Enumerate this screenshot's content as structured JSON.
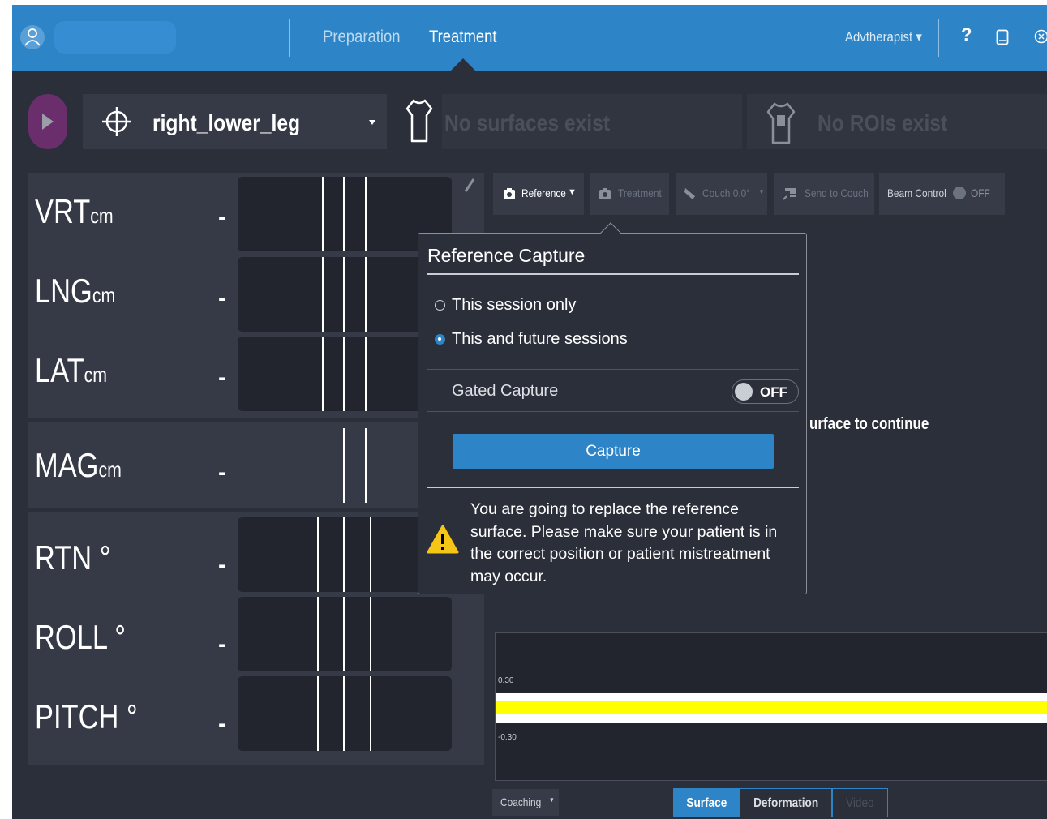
{
  "header": {
    "tabs": [
      {
        "label": "Preparation",
        "active": false
      },
      {
        "label": "Treatment",
        "active": true
      }
    ],
    "user_menu": "Advtherapist",
    "icons": [
      "user-avatar-icon",
      "help-icon",
      "tablet-icon",
      "close-icon"
    ]
  },
  "site": {
    "name": "right_lower_leg",
    "surfaces_text": "No surfaces exist",
    "rois_text": "No ROIs exist"
  },
  "deltas": {
    "rows": [
      {
        "axis": "VRT",
        "unit": "cm",
        "value": "-"
      },
      {
        "axis": "LNG",
        "unit": "cm",
        "value": "-"
      },
      {
        "axis": "LAT",
        "unit": "cm",
        "value": "-"
      },
      {
        "axis": "MAG",
        "unit": "cm",
        "value": "-"
      },
      {
        "axis": "RTN",
        "unit": "°",
        "value": "-"
      },
      {
        "axis": "ROLL",
        "unit": "°",
        "value": "-"
      },
      {
        "axis": "PITCH",
        "unit": "°",
        "value": "-"
      }
    ]
  },
  "toolbar": {
    "reference": "Reference",
    "treatment": "Treatment",
    "couch": "Couch 0.0°",
    "send_to_couch": "Send to Couch",
    "beam_control": "Beam Control",
    "beam_state": "OFF"
  },
  "popup": {
    "title": "Reference Capture",
    "options": [
      {
        "label": "This session only",
        "selected": false
      },
      {
        "label": "This and future sessions",
        "selected": true
      }
    ],
    "gated_label": "Gated Capture",
    "gated_state": "OFF",
    "capture_label": "Capture",
    "warning": "You are going to replace the reference surface. Please make sure your patient is in the correct position or patient mistreatment may occur."
  },
  "behind_text": "urface to continue",
  "chart": {
    "upper_tick": "0.30",
    "lower_tick": "-0.30",
    "colors": {
      "band": "#ffff00",
      "border": "#ffffff"
    }
  },
  "bottom": {
    "coaching": "Coaching",
    "views": [
      {
        "label": "Surface",
        "active": true
      },
      {
        "label": "Deformation",
        "active": false
      },
      {
        "label": "Video",
        "active": false
      }
    ]
  },
  "colors": {
    "accent": "#2d84c6",
    "background": "#2b2f3a",
    "panel": "#353a46",
    "play": "#6a2e6c"
  }
}
